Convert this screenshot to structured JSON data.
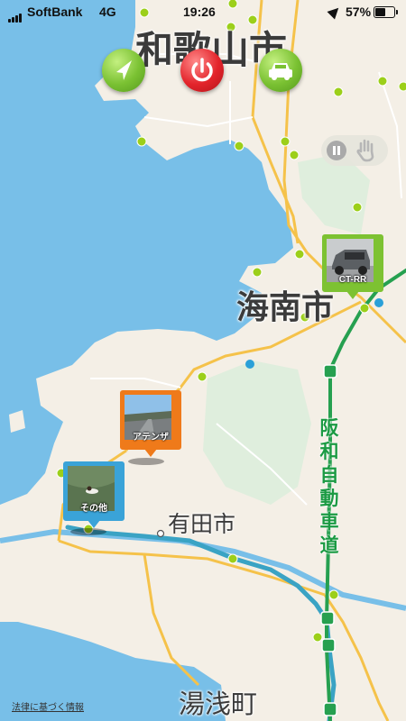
{
  "status_bar": {
    "carrier": "SoftBank",
    "network": "4G",
    "time": "19:26",
    "battery_label": "57%",
    "battery_level": 0.57
  },
  "map": {
    "place_labels": {
      "wakayama": "和歌山市",
      "kainan": "海南市",
      "arida": "有田市",
      "yuasa": "湯浅町"
    },
    "highway_label": [
      "阪",
      "和",
      "自",
      "動",
      "車",
      "道"
    ],
    "colors": {
      "sea": "#78bfe8",
      "land": "#f4efe6",
      "park": "#dfeedd",
      "road_major": "#f5c24a",
      "route": "#3aa3c4",
      "expressway": "#26a050",
      "station": "#9ccf1a"
    }
  },
  "controls": {
    "nav_button": "navigation-arrow-icon",
    "power_button": "power-icon",
    "car_button": "car-icon",
    "toggle_pause": "pause-icon",
    "toggle_hand": "hand-icon"
  },
  "pins": {
    "ct_rr": {
      "label": "CT-RR",
      "color": "#7dc232"
    },
    "atenza": {
      "label": "アテンザ",
      "color": "#ef7a1a"
    },
    "other": {
      "label": "その他",
      "color": "#3aa3d8"
    }
  },
  "footer": {
    "legal_link": "法律に基づく情報"
  }
}
